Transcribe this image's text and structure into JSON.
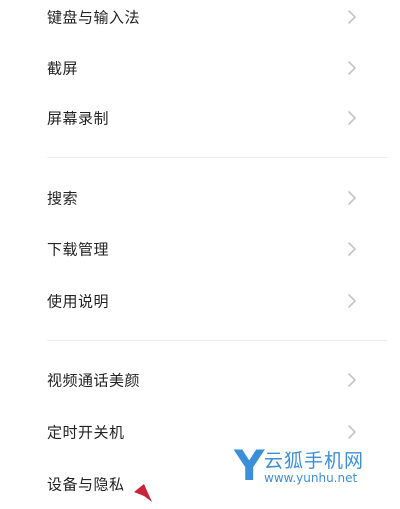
{
  "settings": {
    "items": [
      {
        "label": "键盘与输入法"
      },
      {
        "label": "截屏"
      },
      {
        "label": "屏幕录制"
      },
      {
        "label": "搜索"
      },
      {
        "label": "下载管理"
      },
      {
        "label": "使用说明"
      },
      {
        "label": "视频通话美颜"
      },
      {
        "label": "定时开关机"
      },
      {
        "label": "设备与隐私"
      }
    ]
  },
  "watermark": {
    "logo_letter": "Y",
    "name": "云狐手机网",
    "url": "www.yunhu.net"
  },
  "colors": {
    "text": "#222222",
    "chevron": "#c4c4c4",
    "divider": "#ececec",
    "watermark": "#3b8fd8",
    "cursor": "#c8243a"
  },
  "icons": {
    "chevron": "chevron-right-icon",
    "cursor": "pointer-arrow-icon"
  }
}
